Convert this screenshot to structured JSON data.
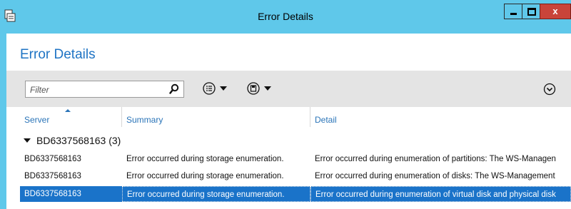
{
  "window": {
    "title": "Error Details",
    "close_label": "x"
  },
  "heading": "Error Details",
  "filter": {
    "placeholder": "Filter"
  },
  "columns": {
    "server": "Server",
    "summary": "Summary",
    "detail": "Detail"
  },
  "group": {
    "label": "BD6337568163 (3)"
  },
  "rows": [
    {
      "server": "BD6337568163",
      "summary": "Error occurred during storage enumeration.",
      "detail": "Error occurred during enumeration of partitions: The WS-Managen"
    },
    {
      "server": "BD6337568163",
      "summary": "Error occurred during storage enumeration.",
      "detail": "Error occurred during enumeration of disks: The WS-Management"
    },
    {
      "server": "BD6337568163",
      "summary": "Error occurred during storage enumeration.",
      "detail": "Error occurred during enumeration of virtual disk and physical disk"
    }
  ],
  "selected_row": 2,
  "colors": {
    "accent": "#5fc8ea",
    "heading": "#1f74c4",
    "selection": "#1a73c9",
    "close": "#c9443a"
  },
  "icons": [
    "app-icon",
    "search-icon",
    "list-icon",
    "save-icon",
    "expand-icon"
  ]
}
